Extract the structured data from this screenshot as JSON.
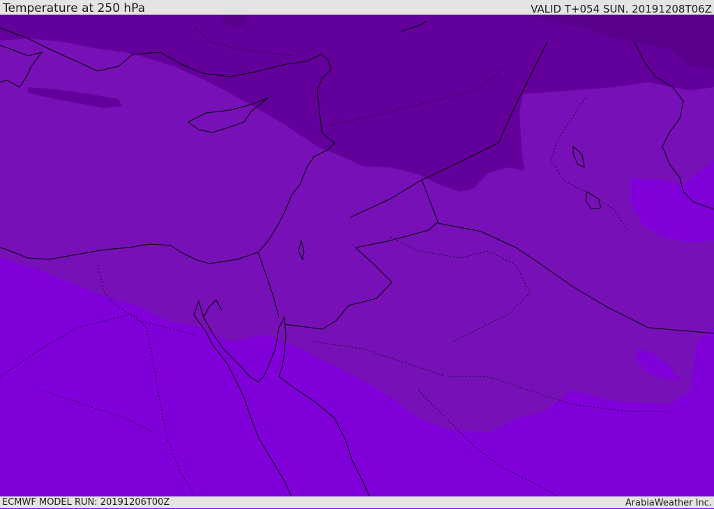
{
  "header": {
    "title": "Temperature at 250 hPa",
    "valid": "VALID T+054 SUN. 20191208T06Z"
  },
  "footer": {
    "model_run": "ECMWF MODEL RUN: 20191206T00Z",
    "credit": "ArabiaWeather Inc."
  },
  "colors": {
    "coldest": "#58008c",
    "colder": "#63009b",
    "cold": "#7711b7",
    "cool": "#7f00d9",
    "borders": "#000000",
    "bars": "#e4e4e4"
  }
}
